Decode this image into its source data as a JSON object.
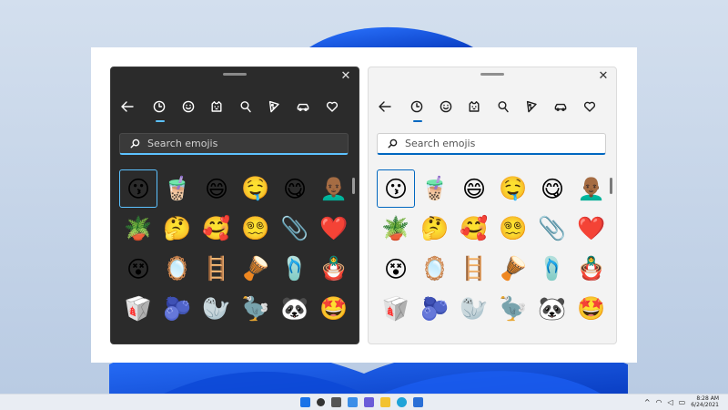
{
  "colors": {
    "accent_dark": "#5cc2ff",
    "accent_light": "#0067c0",
    "dark_panel": "#2b2b2b",
    "light_panel": "#f3f3f3"
  },
  "icons": {
    "close": "close-icon",
    "back": "back-arrow-icon",
    "tabs": [
      "recent-clock-icon",
      "smiley-icon",
      "cat-face-icon",
      "pin-icon",
      "pizza-icon",
      "car-icon",
      "heart-icon"
    ],
    "search": "search-icon"
  },
  "dark_panel": {
    "close_label": "✕",
    "search": {
      "placeholder": "Search emojis",
      "value": ""
    },
    "rows": [
      [
        "😗",
        "🧋",
        "😄",
        "🤤",
        "😋",
        "👨🏾‍🦲"
      ],
      [
        "🪴",
        "🤔",
        "🥰",
        "😵‍💫",
        "📎",
        "❤️"
      ],
      [
        "😵",
        "🪞",
        "🪜",
        "🪘",
        "🩴",
        "🪆"
      ],
      [
        "🥡",
        "🫐",
        "🦭",
        "🦤",
        "🐼",
        "🤩"
      ]
    ]
  },
  "light_panel": {
    "close_label": "✕",
    "search": {
      "placeholder": "Search emojis",
      "value": ""
    },
    "rows": [
      [
        "😗",
        "🧋",
        "😄",
        "🤤",
        "😋",
        "👨🏾‍🦲"
      ],
      [
        "🪴",
        "🤔",
        "🥰",
        "😵‍💫",
        "📎",
        "❤️"
      ],
      [
        "😵",
        "🪞",
        "🪜",
        "🪘",
        "🩴",
        "🪆"
      ],
      [
        "🥡",
        "🫐",
        "🦭",
        "🦤",
        "🐼",
        "🤩"
      ]
    ]
  },
  "taskbar": {
    "icons": [
      "windows-start-icon",
      "search-icon",
      "task-view-icon",
      "widgets-icon",
      "chat-icon",
      "file-explorer-icon",
      "edge-icon",
      "store-icon"
    ],
    "tray": {
      "chevron": "^",
      "time": "8:28 AM",
      "date": "6/24/2021"
    }
  }
}
